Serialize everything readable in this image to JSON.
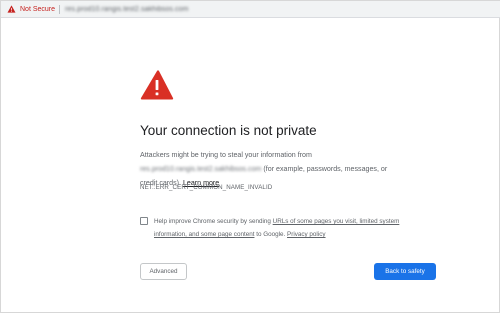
{
  "addressbar": {
    "security_label": "Not Secure",
    "url": "res.prod10.rangis.test2.sakhibsos.com"
  },
  "interstitial": {
    "title": "Your connection is not private",
    "desc_line1": "Attackers might be trying to steal your information from",
    "desc_host": "res.prod10.rangis.test2.sakhibsos.com",
    "desc_line2_rest": " (for example, passwords, messages, or",
    "desc_line3": "credit cards). ",
    "learn_more": "Learn more",
    "error_code": "NET::ERR_CERT_COMMON_NAME_INVALID",
    "checkbox": {
      "checked": false,
      "text_before": "Help improve Chrome security by sending ",
      "link1_part1": "URLs of some pages you visit, limited system",
      "link1_part2": "information, and some page content",
      "text_middle": " to Google. ",
      "link2": "Privacy policy"
    },
    "advanced_label": "Advanced",
    "back_label": "Back to safety"
  },
  "colors": {
    "warning_red": "#d93025",
    "not_secure_red": "#c5221f",
    "primary_blue": "#1a73e8"
  },
  "icons": {
    "address_warning": "warning-triangle-icon",
    "main_warning": "warning-triangle-icon"
  }
}
